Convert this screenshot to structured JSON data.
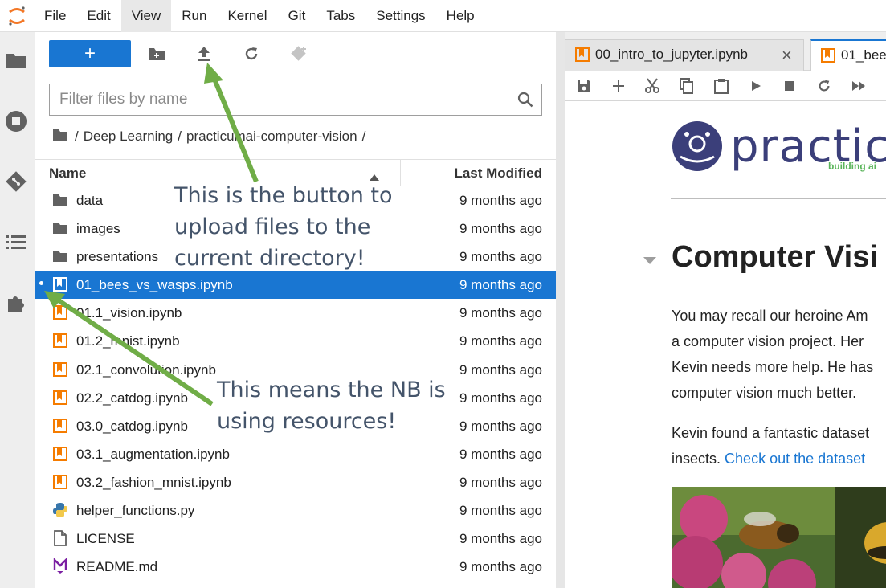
{
  "menubar": {
    "items": [
      "File",
      "Edit",
      "View",
      "Run",
      "Kernel",
      "Git",
      "Tabs",
      "Settings",
      "Help"
    ],
    "active": "View"
  },
  "activitybar": {
    "icons": [
      "folder-icon",
      "running-icon",
      "git-icon",
      "toc-icon",
      "extension-icon"
    ]
  },
  "filebrowser": {
    "new_button_label": "+",
    "filter_placeholder": "Filter files by name",
    "breadcrumb": [
      "/",
      "Deep Learning",
      "/",
      "practicumai-computer-vision",
      "/"
    ],
    "header": {
      "name": "Name",
      "last_modified": "Last Modified"
    },
    "files": [
      {
        "name": "data",
        "modified": "9 months ago",
        "type": "folder"
      },
      {
        "name": "images",
        "modified": "9 months ago",
        "type": "folder"
      },
      {
        "name": "presentations",
        "modified": "9 months ago",
        "type": "folder"
      },
      {
        "name": "01_bees_vs_wasps.ipynb",
        "modified": "9 months ago",
        "type": "notebook",
        "selected": true,
        "running": true
      },
      {
        "name": "01.1_vision.ipynb",
        "modified": "9 months ago",
        "type": "notebook"
      },
      {
        "name": "01.2_mnist.ipynb",
        "modified": "9 months ago",
        "type": "notebook"
      },
      {
        "name": "02.1_convolution.ipynb",
        "modified": "9 months ago",
        "type": "notebook"
      },
      {
        "name": "02.2_catdog.ipynb",
        "modified": "9 months ago",
        "type": "notebook"
      },
      {
        "name": "03.0_catdog.ipynb",
        "modified": "9 months ago",
        "type": "notebook"
      },
      {
        "name": "03.1_augmentation.ipynb",
        "modified": "9 months ago",
        "type": "notebook"
      },
      {
        "name": "03.2_fashion_mnist.ipynb",
        "modified": "9 months ago",
        "type": "notebook"
      },
      {
        "name": "helper_functions.py",
        "modified": "9 months ago",
        "type": "python"
      },
      {
        "name": "LICENSE",
        "modified": "9 months ago",
        "type": "file"
      },
      {
        "name": "README.md",
        "modified": "9 months ago",
        "type": "markdown"
      }
    ]
  },
  "tabs": [
    {
      "label": "00_intro_to_jupyter.ipynb",
      "active": false,
      "close": "×"
    },
    {
      "label": "01_bee",
      "active": true
    }
  ],
  "notebook": {
    "brand": "practic",
    "brand_sub": "building ai",
    "heading": "Computer Visi",
    "paragraph1": [
      "You may recall our heroine Am",
      "a computer vision project. Her",
      "Kevin needs more help. He has",
      "computer vision much better."
    ],
    "paragraph2_line1": "Kevin found a fantastic dataset",
    "paragraph2_line2_prefix": "insects.",
    "paragraph2_link": "Check out the dataset"
  },
  "annotations": {
    "upload_note": [
      "This is the button to",
      "upload files to the",
      "current directory!"
    ],
    "running_note": [
      "This means the NB is",
      "using resources!"
    ]
  },
  "colors": {
    "accent": "#1976d2",
    "notebook_icon": "#f57c00",
    "arrow": "#70ad47",
    "annotation_text": "#44546a"
  }
}
